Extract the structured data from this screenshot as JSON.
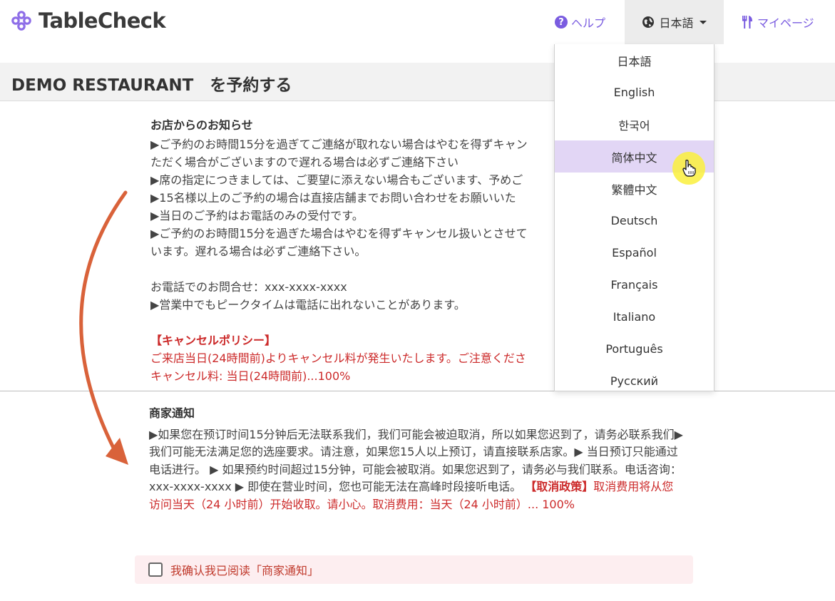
{
  "header": {
    "logo_text": "TableCheck",
    "help_label": "ヘルプ",
    "language_label": "日本語",
    "mypage_label": "マイページ",
    "icons": {
      "logo": "tablecheck-logo",
      "help": "question-circle-icon",
      "language": "globe-icon",
      "mypage": "fork-knife-icon"
    }
  },
  "page_title": "DEMO RESTAURANT　を予約する",
  "notice_original": {
    "heading": "お店からのお知らせ",
    "lines": [
      "▶ご予約のお時間15分を過ぎてご連絡が取れない場合はやむを得ずキャン",
      "ただく場合がございますので遅れる場合は必ずご連絡下さい",
      "▶席の指定につきましては、ご要望に添えない場合もございます、予めご",
      "▶15名様以上のご予約の場合は直接店舗までお問い合わせをお願いいた",
      "▶当日のご予約はお電話のみの受付です。",
      "▶ご予約のお時間15分を過ぎた場合はやむを得ずキャンセル扱いとさせて",
      "います。遅れる場合は必ずご連絡下さい。"
    ],
    "phone_line": "お電話でのお問合せ：xxx-xxxx-xxxx",
    "peak_line": "▶営業中でもピークタイムは電話に出れないことがあります。",
    "cancel_heading": "【キャンセルポリシー】",
    "cancel_line1": "ご来店当日(24時間前)よりキャンセル料が発生いたします。ご注意くださ",
    "cancel_line2": "キャンセル料: 当日(24時間前)...100%"
  },
  "notice_translated": {
    "heading": "商家通知",
    "body": "▶如果您在预订时间15分钟后无法联系我们，我们可能会被迫取消，所以如果您迟到了，请务必联系我们▶我们可能无法满足您的选座要求。请注意，如果您15人以上预订，请直接联系店家。▶ 当日预订只能通过电话进行。 ▶ 如果预约时间超过15分钟，可能会被取消。如果您迟到了，请务必与我们联系。电话咨询：xxx-xxxx-xxxx ▶ 即使在营业时间，您也可能无法在高峰时段接听电话。 ",
    "cancel_heading": "【取消政策】",
    "cancel_text": "取消费用将从您访问当天（24 小时前）开始收取。请小心。取消费用：当天（24 小时前）... 100%"
  },
  "confirm_label": "我确认我已阅读「商家通知」",
  "language_menu": {
    "items": [
      "日本語",
      "English",
      "한국어",
      "简体中文",
      "繁體中文",
      "Deutsch",
      "Español",
      "Français",
      "Italiano",
      "Português",
      "Русский"
    ],
    "highlighted": "简体中文"
  },
  "colors": {
    "brand": "#7a5ce0",
    "alert": "#cc2a2a",
    "arrow": "#d9623a",
    "highlight": "#e2d6f5",
    "confirm_bg": "#fdeef0"
  }
}
